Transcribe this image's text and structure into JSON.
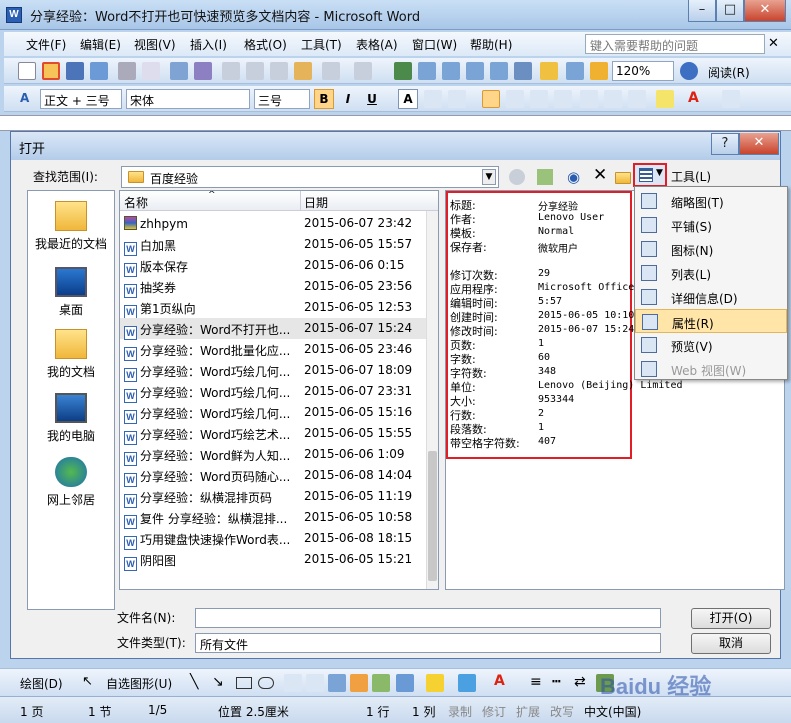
{
  "window": {
    "title": "分享经验：Word不打开也可快速预览多文档内容 - Microsoft Word",
    "icon": "word-icon"
  },
  "menubar": {
    "items": [
      "文件(F)",
      "编辑(E)",
      "视图(V)",
      "插入(I)",
      "格式(O)",
      "工具(T)",
      "表格(A)",
      "窗口(W)",
      "帮助(H)"
    ],
    "help_placeholder": "键入需要帮助的问题"
  },
  "standard_toolbar": {
    "zoom": "120%",
    "read_label": "阅读(R)"
  },
  "format_toolbar": {
    "style": "正文 + 三号",
    "font": "宋体",
    "size": "三号",
    "bold": "B",
    "italic": "I",
    "underline": "U",
    "char_border": "A"
  },
  "dialog": {
    "title": "打开",
    "lookin_label": "查找范围(I):",
    "lookin_value": "百度经验",
    "tools_label": "工具(L)",
    "places": [
      {
        "label": "我最近的文档",
        "icon": "recent-documents-icon"
      },
      {
        "label": "桌面",
        "icon": "desktop-icon"
      },
      {
        "label": "我的文档",
        "icon": "my-documents-icon"
      },
      {
        "label": "我的电脑",
        "icon": "my-computer-icon"
      },
      {
        "label": "网上邻居",
        "icon": "network-icon"
      }
    ],
    "columns": {
      "name": "名称",
      "date": "日期"
    },
    "files": [
      {
        "name": "zhhpym",
        "date": "2015-06-07 23:42",
        "type": "rar"
      },
      {
        "name": "白加黑",
        "date": "2015-06-05 15:57",
        "type": "doc"
      },
      {
        "name": "版本保存",
        "date": "2015-06-06 0:15",
        "type": "doc"
      },
      {
        "name": "抽奖券",
        "date": "2015-06-05 23:56",
        "type": "doc"
      },
      {
        "name": "第1页纵向",
        "date": "2015-06-05 12:53",
        "type": "doc"
      },
      {
        "name": "分享经验：Word不打开也...",
        "date": "2015-06-07 15:24",
        "type": "doc",
        "selected": true
      },
      {
        "name": "分享经验：Word批量化应...",
        "date": "2015-06-05 23:46",
        "type": "doc"
      },
      {
        "name": "分享经验：Word巧绘几何...",
        "date": "2015-06-07 18:09",
        "type": "doc"
      },
      {
        "name": "分享经验：Word巧绘几何...",
        "date": "2015-06-07 23:31",
        "type": "doc"
      },
      {
        "name": "分享经验：Word巧绘几何...",
        "date": "2015-06-05 15:16",
        "type": "doc"
      },
      {
        "name": "分享经验：Word巧绘艺术...",
        "date": "2015-06-05 15:55",
        "type": "doc"
      },
      {
        "name": "分享经验：Word鲜为人知...",
        "date": "2015-06-06 1:09",
        "type": "doc"
      },
      {
        "name": "分享经验：Word页码随心...",
        "date": "2015-06-08 14:04",
        "type": "doc"
      },
      {
        "name": "分享经验：纵横混排页码",
        "date": "2015-06-05 11:19",
        "type": "doc"
      },
      {
        "name": "复件 分享经验：纵横混排...",
        "date": "2015-06-05 10:58",
        "type": "doc"
      },
      {
        "name": "巧用键盘快速操作Word表...",
        "date": "2015-06-08 18:15",
        "type": "doc"
      },
      {
        "name": "阴阳图",
        "date": "2015-06-05 15:21",
        "type": "doc"
      }
    ],
    "properties_a": [
      {
        "k": "标题:",
        "v": "分享经验"
      },
      {
        "k": "作者:",
        "v": "Lenovo User"
      },
      {
        "k": "模板:",
        "v": "Normal"
      },
      {
        "k": "保存者:",
        "v": "微软用户"
      }
    ],
    "properties_b": [
      {
        "k": "修订次数:",
        "v": "29"
      },
      {
        "k": "应用程序:",
        "v": "Microsoft Office"
      },
      {
        "k": "编辑时间:",
        "v": "5:57"
      },
      {
        "k": "创建时间:",
        "v": "2015-06-05 10:10"
      },
      {
        "k": "修改时间:",
        "v": "2015-06-07 15:24"
      },
      {
        "k": "页数:",
        "v": "1"
      },
      {
        "k": "字数:",
        "v": "60"
      },
      {
        "k": "字符数:",
        "v": "348"
      },
      {
        "k": "单位:",
        "v": "Lenovo (Beijing) Limited"
      },
      {
        "k": "大小:",
        "v": "953344"
      },
      {
        "k": "行数:",
        "v": "2"
      },
      {
        "k": "段落数:",
        "v": "1"
      },
      {
        "k": "带空格字符数:",
        "v": "407"
      }
    ],
    "view_menu": [
      {
        "label": "缩略图(T)",
        "icon": "thumbnails-icon"
      },
      {
        "label": "平铺(S)",
        "icon": "tiles-icon"
      },
      {
        "label": "图标(N)",
        "icon": "icons-icon"
      },
      {
        "label": "列表(L)",
        "icon": "list-icon"
      },
      {
        "label": "详细信息(D)",
        "icon": "details-icon"
      },
      {
        "label": "属性(R)",
        "icon": "properties-icon",
        "highlighted": true
      },
      {
        "label": "预览(V)",
        "icon": "preview-icon"
      },
      {
        "label": "Web 视图(W)",
        "icon": "web-view-icon",
        "disabled": true
      }
    ],
    "filename_label": "文件名(N):",
    "filename_value": "",
    "filetype_label": "文件类型(T):",
    "filetype_value": "所有文件",
    "open_button": "打开(O)",
    "cancel_button": "取消",
    "help_button": "?"
  },
  "drawbar": {
    "draw": "绘图(D)",
    "autoshapes": "自选图形(U)"
  },
  "statusbar": {
    "page": "1 页",
    "section": "1 节",
    "pages": "1/5",
    "position": "位置 2.5厘米",
    "line": "1 行",
    "col": "1 列",
    "rec": "录制",
    "trk": "修订",
    "ext": "扩展",
    "ovr": "改写",
    "lang": "中文(中国)"
  },
  "watermark": "Baidu 经验",
  "colors": {
    "highlight_red": "#e21d26",
    "menu_highlight": "#ffe5a8",
    "title_gradient": "#a9c6e8"
  }
}
